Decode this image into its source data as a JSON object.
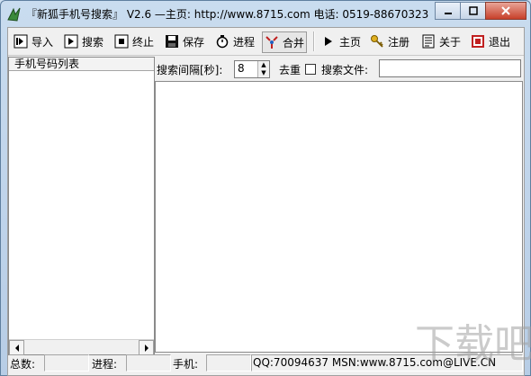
{
  "window": {
    "title": "『新狐手机号搜索』 V2.6  —主页: http://www.8715.com 电话: 0519-88670323"
  },
  "toolbar": {
    "import": "导入",
    "search": "搜索",
    "stop": "终止",
    "save": "保存",
    "progress": "进程",
    "merge": "合并",
    "home": "主页",
    "register": "注册",
    "about": "关于",
    "exit": "退出"
  },
  "left_panel": {
    "header": "手机号码列表"
  },
  "options": {
    "interval_label": "搜索间隔[秒]:",
    "interval_value": "8",
    "dedupe_label": "去重",
    "file_label": "搜索文件:",
    "file_value": ""
  },
  "status": {
    "total_label": "总数:",
    "progress_label": "进程:",
    "phone_label": "手机:",
    "contact": "QQ:70094637 MSN:www.8715.com@LIVE.CN"
  },
  "watermark": "下载吧",
  "colors": {
    "window_frame": "#b7cde6",
    "close_button": "#c7402a"
  }
}
